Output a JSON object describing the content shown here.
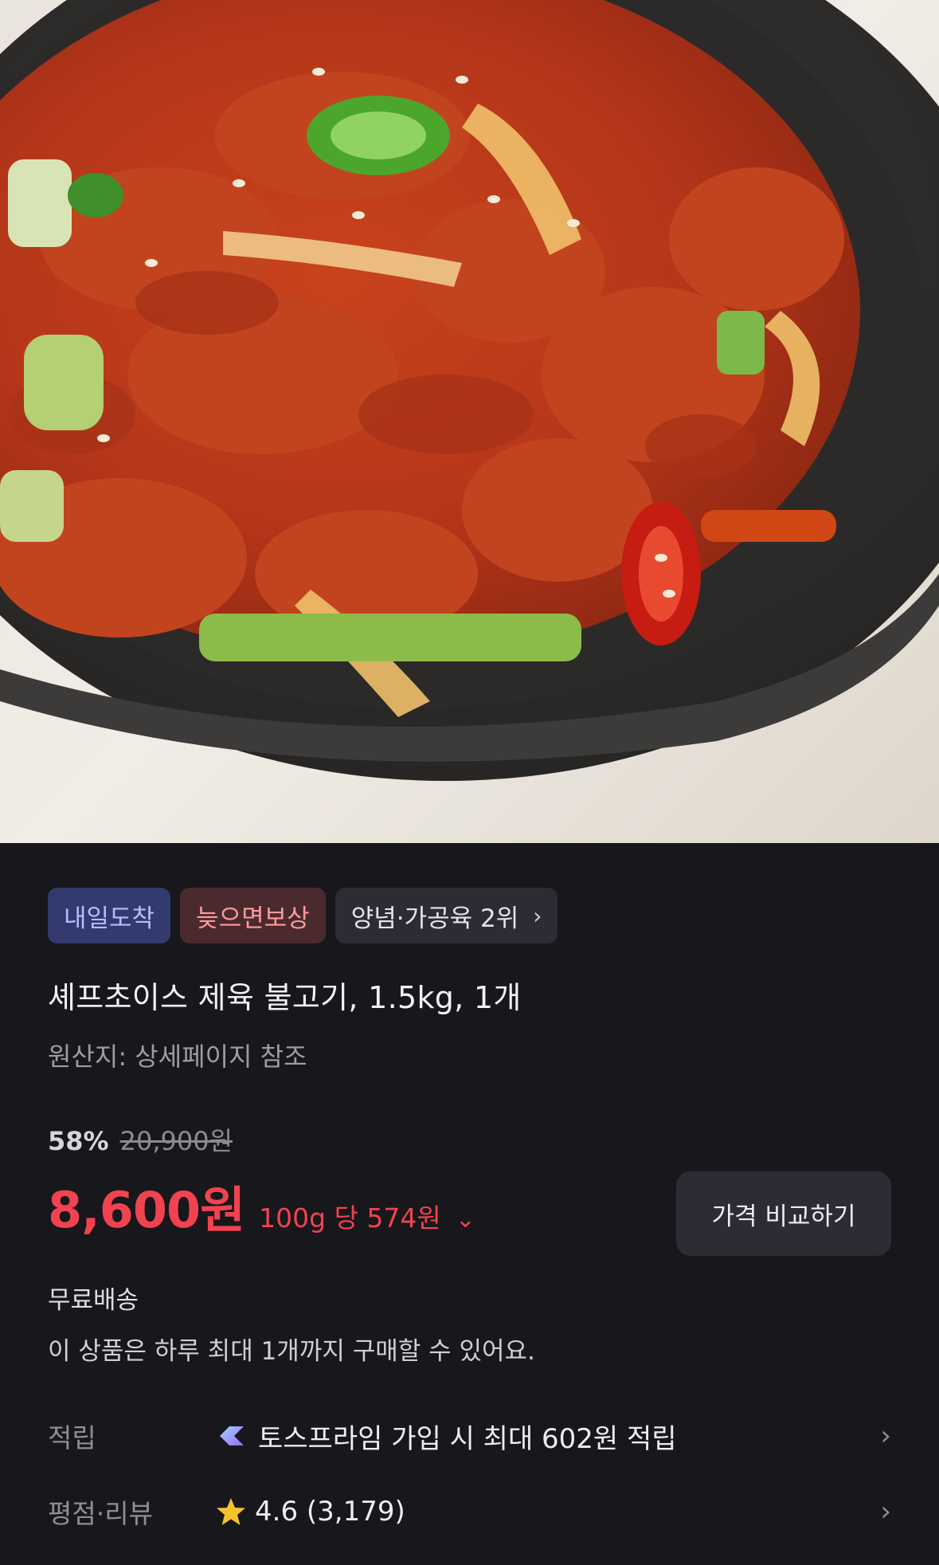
{
  "product": {
    "image_alt": "spicy pork bulgogi in a black stone pan",
    "badges": {
      "arrival": "내일도착",
      "compensation": "늦으면보상",
      "rank": "양념·가공육 2위",
      "rank_chevron": "›"
    },
    "title": "셰프초이스 제육 불고기, 1.5kg, 1개",
    "origin": "원산지: 상세페이지 참조"
  },
  "pricing": {
    "discount": "58%",
    "original_price": "20,900원",
    "price": "8,600원",
    "unit_price": "100g 당 574원",
    "unit_chevron": "⌄",
    "compare_button": "가격 비교하기"
  },
  "shipping": {
    "label": "무료배송",
    "limit_notice": "이 상품은 하루 최대 1개까지 구매할 수 있어요."
  },
  "rewards": {
    "label": "적립",
    "icon": "toss-prime-icon",
    "text": "토스프라임 가입 시 최대 602원 적립",
    "chevron": "›"
  },
  "reviews": {
    "label": "평점·리뷰",
    "icon": "star-icon",
    "rating": "4.6 (3,179)",
    "chevron": "›"
  },
  "colors": {
    "background": "#17171c",
    "price_red": "#f0434f",
    "arrival_badge": "#333a6e",
    "compensation_badge": "#4a2a2d",
    "star": "#f6c22b"
  }
}
